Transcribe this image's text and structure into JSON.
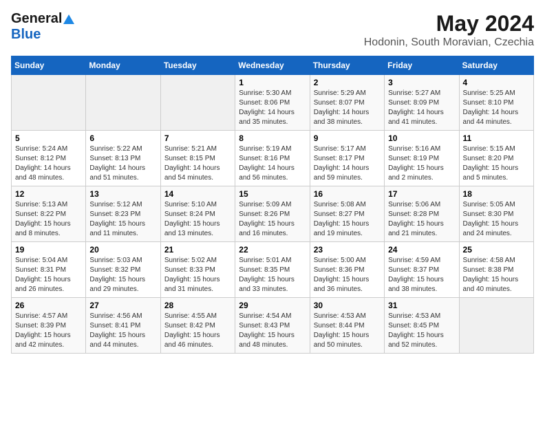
{
  "logo": {
    "general": "General",
    "blue": "Blue"
  },
  "title": "May 2024",
  "location": "Hodonin, South Moravian, Czechia",
  "days_header": [
    "Sunday",
    "Monday",
    "Tuesday",
    "Wednesday",
    "Thursday",
    "Friday",
    "Saturday"
  ],
  "weeks": [
    [
      {
        "day": "",
        "detail": ""
      },
      {
        "day": "",
        "detail": ""
      },
      {
        "day": "",
        "detail": ""
      },
      {
        "day": "1",
        "detail": "Sunrise: 5:30 AM\nSunset: 8:06 PM\nDaylight: 14 hours\nand 35 minutes."
      },
      {
        "day": "2",
        "detail": "Sunrise: 5:29 AM\nSunset: 8:07 PM\nDaylight: 14 hours\nand 38 minutes."
      },
      {
        "day": "3",
        "detail": "Sunrise: 5:27 AM\nSunset: 8:09 PM\nDaylight: 14 hours\nand 41 minutes."
      },
      {
        "day": "4",
        "detail": "Sunrise: 5:25 AM\nSunset: 8:10 PM\nDaylight: 14 hours\nand 44 minutes."
      }
    ],
    [
      {
        "day": "5",
        "detail": "Sunrise: 5:24 AM\nSunset: 8:12 PM\nDaylight: 14 hours\nand 48 minutes."
      },
      {
        "day": "6",
        "detail": "Sunrise: 5:22 AM\nSunset: 8:13 PM\nDaylight: 14 hours\nand 51 minutes."
      },
      {
        "day": "7",
        "detail": "Sunrise: 5:21 AM\nSunset: 8:15 PM\nDaylight: 14 hours\nand 54 minutes."
      },
      {
        "day": "8",
        "detail": "Sunrise: 5:19 AM\nSunset: 8:16 PM\nDaylight: 14 hours\nand 56 minutes."
      },
      {
        "day": "9",
        "detail": "Sunrise: 5:17 AM\nSunset: 8:17 PM\nDaylight: 14 hours\nand 59 minutes."
      },
      {
        "day": "10",
        "detail": "Sunrise: 5:16 AM\nSunset: 8:19 PM\nDaylight: 15 hours\nand 2 minutes."
      },
      {
        "day": "11",
        "detail": "Sunrise: 5:15 AM\nSunset: 8:20 PM\nDaylight: 15 hours\nand 5 minutes."
      }
    ],
    [
      {
        "day": "12",
        "detail": "Sunrise: 5:13 AM\nSunset: 8:22 PM\nDaylight: 15 hours\nand 8 minutes."
      },
      {
        "day": "13",
        "detail": "Sunrise: 5:12 AM\nSunset: 8:23 PM\nDaylight: 15 hours\nand 11 minutes."
      },
      {
        "day": "14",
        "detail": "Sunrise: 5:10 AM\nSunset: 8:24 PM\nDaylight: 15 hours\nand 13 minutes."
      },
      {
        "day": "15",
        "detail": "Sunrise: 5:09 AM\nSunset: 8:26 PM\nDaylight: 15 hours\nand 16 minutes."
      },
      {
        "day": "16",
        "detail": "Sunrise: 5:08 AM\nSunset: 8:27 PM\nDaylight: 15 hours\nand 19 minutes."
      },
      {
        "day": "17",
        "detail": "Sunrise: 5:06 AM\nSunset: 8:28 PM\nDaylight: 15 hours\nand 21 minutes."
      },
      {
        "day": "18",
        "detail": "Sunrise: 5:05 AM\nSunset: 8:30 PM\nDaylight: 15 hours\nand 24 minutes."
      }
    ],
    [
      {
        "day": "19",
        "detail": "Sunrise: 5:04 AM\nSunset: 8:31 PM\nDaylight: 15 hours\nand 26 minutes."
      },
      {
        "day": "20",
        "detail": "Sunrise: 5:03 AM\nSunset: 8:32 PM\nDaylight: 15 hours\nand 29 minutes."
      },
      {
        "day": "21",
        "detail": "Sunrise: 5:02 AM\nSunset: 8:33 PM\nDaylight: 15 hours\nand 31 minutes."
      },
      {
        "day": "22",
        "detail": "Sunrise: 5:01 AM\nSunset: 8:35 PM\nDaylight: 15 hours\nand 33 minutes."
      },
      {
        "day": "23",
        "detail": "Sunrise: 5:00 AM\nSunset: 8:36 PM\nDaylight: 15 hours\nand 36 minutes."
      },
      {
        "day": "24",
        "detail": "Sunrise: 4:59 AM\nSunset: 8:37 PM\nDaylight: 15 hours\nand 38 minutes."
      },
      {
        "day": "25",
        "detail": "Sunrise: 4:58 AM\nSunset: 8:38 PM\nDaylight: 15 hours\nand 40 minutes."
      }
    ],
    [
      {
        "day": "26",
        "detail": "Sunrise: 4:57 AM\nSunset: 8:39 PM\nDaylight: 15 hours\nand 42 minutes."
      },
      {
        "day": "27",
        "detail": "Sunrise: 4:56 AM\nSunset: 8:41 PM\nDaylight: 15 hours\nand 44 minutes."
      },
      {
        "day": "28",
        "detail": "Sunrise: 4:55 AM\nSunset: 8:42 PM\nDaylight: 15 hours\nand 46 minutes."
      },
      {
        "day": "29",
        "detail": "Sunrise: 4:54 AM\nSunset: 8:43 PM\nDaylight: 15 hours\nand 48 minutes."
      },
      {
        "day": "30",
        "detail": "Sunrise: 4:53 AM\nSunset: 8:44 PM\nDaylight: 15 hours\nand 50 minutes."
      },
      {
        "day": "31",
        "detail": "Sunrise: 4:53 AM\nSunset: 8:45 PM\nDaylight: 15 hours\nand 52 minutes."
      },
      {
        "day": "",
        "detail": ""
      }
    ]
  ]
}
